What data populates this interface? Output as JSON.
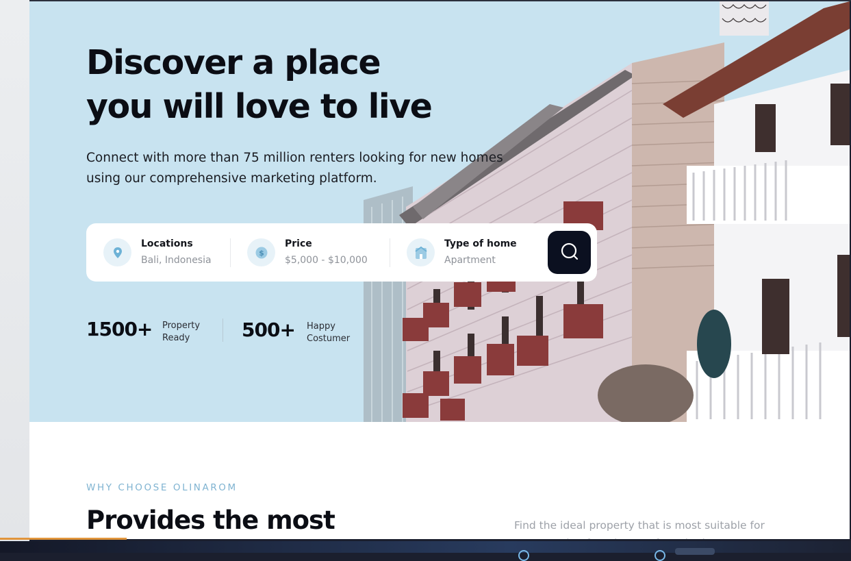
{
  "hero": {
    "title_line1": "Discover a place",
    "title_line2": "you will love to live",
    "subtitle": "Connect with more than 75 million renters looking for new homes using our comprehensive marketing platform."
  },
  "search": {
    "location": {
      "label": "Locations",
      "value": "Bali, Indonesia",
      "icon": "location-pin-icon"
    },
    "price": {
      "label": "Price",
      "value": "$5,000 - $10,000",
      "icon": "dollar-icon"
    },
    "home_type": {
      "label": "Type of home",
      "value": "Apartment",
      "icon": "house-icon"
    },
    "button_icon": "search-icon"
  },
  "stats": [
    {
      "number": "1500+",
      "label_line1": "Property",
      "label_line2": "Ready"
    },
    {
      "number": "500+",
      "label_line1": "Happy",
      "label_line2": "Costumer"
    }
  ],
  "section": {
    "eyebrow": "WHY CHOOSE OLINAROM",
    "title": "Provides the most",
    "description": "Find the ideal property that is most suitable for you. Starting from houses for sale that are"
  },
  "colors": {
    "hero_bg": "#c8e3f0",
    "accent": "#7fb3d1",
    "dark": "#0b1020",
    "progress": "#e1953c"
  }
}
